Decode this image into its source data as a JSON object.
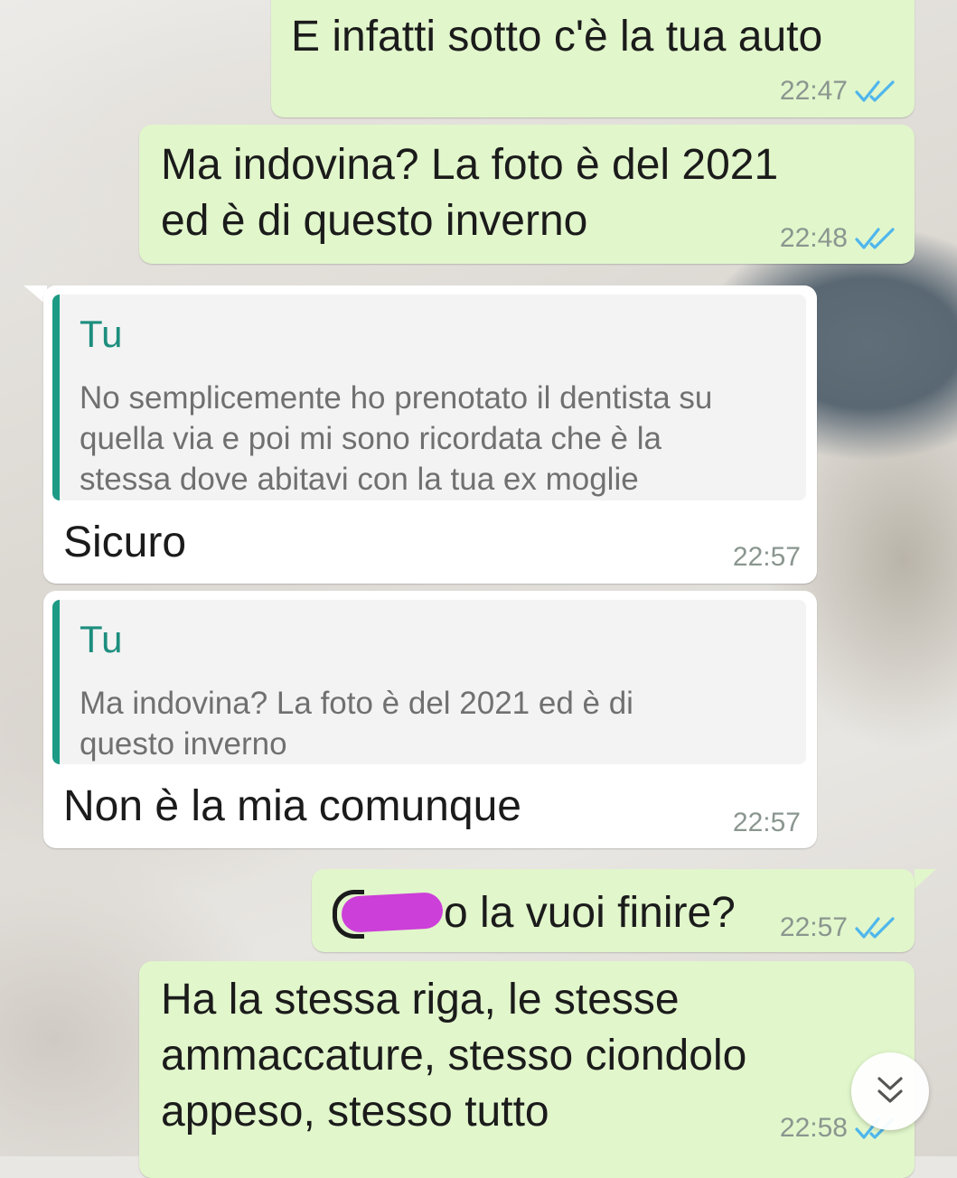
{
  "colors": {
    "outgoing_bubble": "#e1f6cb",
    "incoming_bubble": "#ffffff",
    "reply_accent": "#1d9b84",
    "read_ticks": "#4fb6ec",
    "redaction": "#cc3fd9"
  },
  "messages": [
    {
      "direction": "outgoing",
      "text": "E infatti sotto c'è la tua auto",
      "time": "22:47",
      "status_icon": "double-check-read-icon"
    },
    {
      "direction": "outgoing",
      "text": "Ma indovina? La foto è del 2021\ned è di questo inverno",
      "time": "22:48",
      "status_icon": "double-check-read-icon"
    },
    {
      "direction": "incoming",
      "quoted": {
        "author": "Tu",
        "text": "No semplicemente ho prenotato il dentista su\nquella via e poi mi sono ricordata che è la\nstessa dove abitavi con la tua ex moglie"
      },
      "text": "Sicuro",
      "time": "22:57"
    },
    {
      "direction": "incoming",
      "quoted": {
        "author": "Tu",
        "text": "Ma indovina? La foto è del 2021 ed è di\nquesto inverno"
      },
      "text": "Non è la mia comunque",
      "time": "22:57"
    },
    {
      "direction": "outgoing",
      "text": "o la vuoi finire?",
      "redacted_prefix": true,
      "time": "22:57",
      "status_icon": "double-check-read-icon"
    },
    {
      "direction": "outgoing",
      "text": "Ha la stessa riga, le stesse\nammaccature, stesso ciondolo\nappeso, stesso tutto",
      "time": "22:58",
      "status_icon": "double-check-read-icon"
    }
  ],
  "scroll_down_button": {
    "icon": "double-chevron-down-icon"
  }
}
